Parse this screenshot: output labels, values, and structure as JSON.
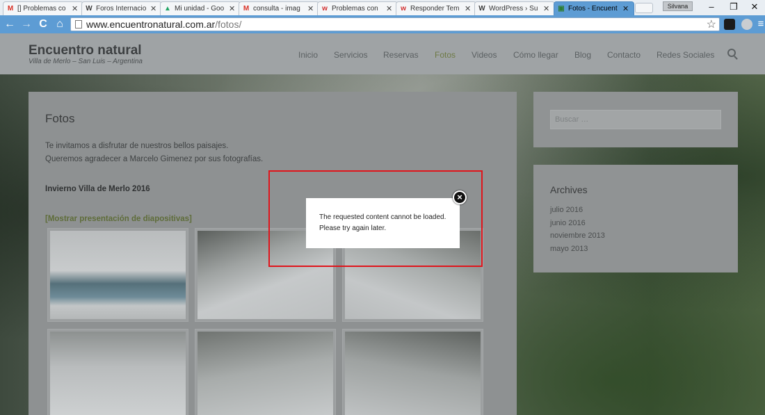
{
  "browser": {
    "tabs": [
      {
        "title": "[] Problemas co",
        "favicon": "gmail-icon",
        "fav_glyph": "M",
        "fav_color": "#d93025",
        "active": false
      },
      {
        "title": "Foros Internacio",
        "favicon": "wordpress-icon",
        "fav_glyph": "W",
        "fav_color": "#3c3c3c",
        "active": false
      },
      {
        "title": "Mi unidad - Goo",
        "favicon": "drive-icon",
        "fav_glyph": "▲",
        "fav_color": "#1fa463",
        "active": false
      },
      {
        "title": "consulta - imag",
        "favicon": "gmail-icon",
        "fav_glyph": "M",
        "fav_color": "#d93025",
        "active": false
      },
      {
        "title": "Problemas con",
        "favicon": "wix-icon",
        "fav_glyph": "w",
        "fav_color": "#d12c2c",
        "active": false
      },
      {
        "title": "Responder Tem",
        "favicon": "wix-icon",
        "fav_glyph": "w",
        "fav_color": "#d12c2c",
        "active": false
      },
      {
        "title": "WordPress › Su",
        "favicon": "wordpress-icon",
        "fav_glyph": "W",
        "fav_color": "#3c3c3c",
        "active": false
      },
      {
        "title": "Fotos - Encuent",
        "favicon": "site-icon",
        "fav_glyph": "▣",
        "fav_color": "#2e7d32",
        "active": true
      }
    ],
    "user": "Silvana",
    "url_domain": "www.encuentronatural.com.ar",
    "url_path": "/fotos/",
    "window_controls": {
      "minimize": "–",
      "restore": "❐",
      "close": "✕"
    },
    "nav_glyphs": {
      "back": "←",
      "forward": "→",
      "reload": "C",
      "home": "⌂",
      "star": "☆",
      "menu": "≡"
    }
  },
  "site": {
    "title": "Encuentro natural",
    "tagline": "Villa de Merlo – San Luis – Argentina",
    "nav": [
      {
        "label": "Inicio",
        "active": false
      },
      {
        "label": "Servicios",
        "active": false
      },
      {
        "label": "Reservas",
        "active": false
      },
      {
        "label": "Fotos",
        "active": true
      },
      {
        "label": "Videos",
        "active": false
      },
      {
        "label": "Cómo llegar",
        "active": false
      },
      {
        "label": "Blog",
        "active": false
      },
      {
        "label": "Contacto",
        "active": false
      },
      {
        "label": "Redes Sociales",
        "active": false
      }
    ]
  },
  "content": {
    "heading": "Fotos",
    "intro_line1": "Te invitamos a disfrutar de nuestros bellos paisajes.",
    "intro_line2": "Queremos agradecer a Marcelo Gimenez por sus fotografías.",
    "gallery_title": "Invierno Villa de Merlo 2016",
    "slideshow_link": "[Mostrar presentación de diapositivas]"
  },
  "sidebar": {
    "search_placeholder": "Buscar …",
    "archives_title": "Archives",
    "archives": [
      "julio 2016",
      "junio 2016",
      "noviembre 2013",
      "mayo 2013"
    ]
  },
  "lightbox": {
    "message_line1": "The requested content cannot be loaded.",
    "message_line2": "Please try again later.",
    "close_glyph": "×"
  },
  "colors": {
    "browser_accent": "#5d9cd4",
    "highlight_outline": "#e0141b",
    "active_nav": "#6e7a45"
  }
}
